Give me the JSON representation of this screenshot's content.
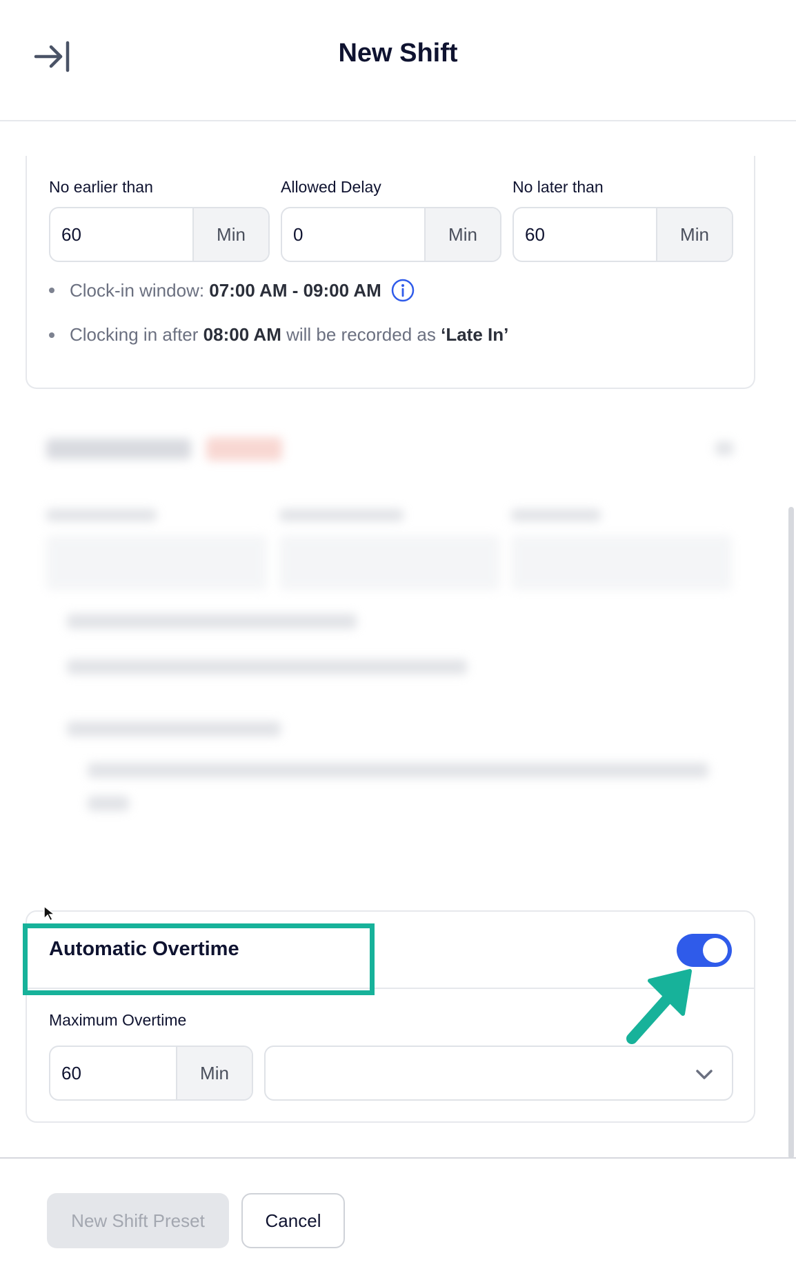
{
  "header": {
    "title": "New Shift"
  },
  "clock_in": {
    "no_earlier_label": "No earlier than",
    "no_earlier_value": "60",
    "allowed_delay_label": "Allowed Delay",
    "allowed_delay_value": "0",
    "no_later_label": "No later than",
    "no_later_value": "60",
    "unit": "Min",
    "window_prefix": "Clock-in window: ",
    "window_value": "07:00 AM - 09:00 AM",
    "late_prefix": "Clocking in after ",
    "late_time": "08:00 AM",
    "late_middle": " will be recorded as ",
    "late_label": "‘Late In’"
  },
  "overtime": {
    "title": "Automatic Overtime",
    "enabled": true,
    "max_label": "Maximum Overtime",
    "max_value": "60",
    "unit": "Min",
    "select_value": ""
  },
  "footer": {
    "preset_label": "New Shift Preset",
    "cancel_label": "Cancel"
  },
  "colors": {
    "accent": "#2f5bea",
    "annotation": "#17b29a"
  }
}
